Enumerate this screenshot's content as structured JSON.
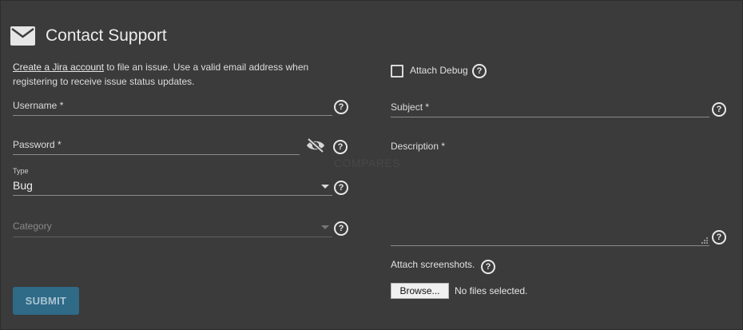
{
  "header": {
    "title": "Contact Support",
    "icon": "envelope-icon"
  },
  "intro": {
    "link_text": "Create a Jira account",
    "text": " to file an issue. Use a valid email address when registering to receive issue status updates."
  },
  "left": {
    "username_label": "Username *",
    "password_label": "Password *",
    "type_label": "Type",
    "type_value": "Bug",
    "category_placeholder": "Category",
    "submit_label": "SUBMIT"
  },
  "right": {
    "attach_debug_label": "Attach Debug",
    "attach_debug_checked": false,
    "subject_label": "Subject *",
    "description_label": "Description *",
    "attach_screenshots_label": "Attach screenshots.",
    "browse_label": "Browse...",
    "no_files_text": "No files selected."
  },
  "watermark": "COMPARES",
  "colors": {
    "background": "#3b3b3b",
    "submit": "#2f6a87",
    "text": "#e6e6e6"
  }
}
